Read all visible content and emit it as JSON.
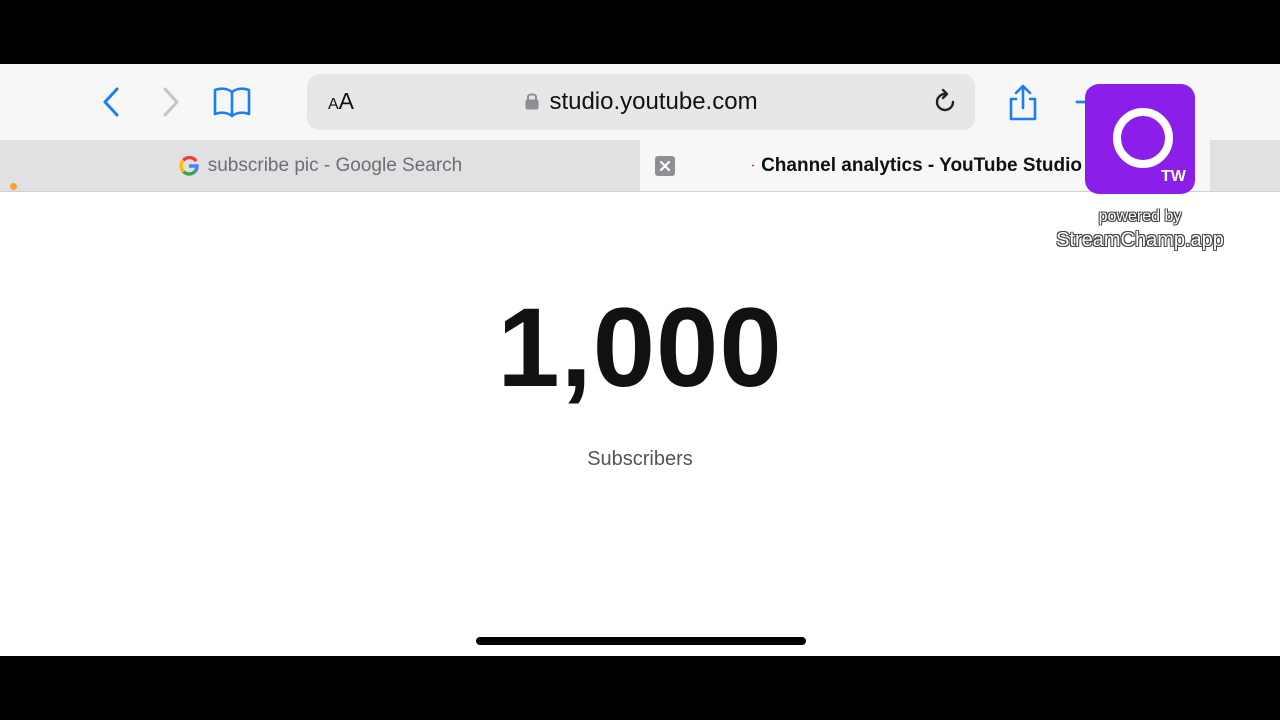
{
  "browser": {
    "address_bar": {
      "text_size_label_small": "A",
      "text_size_label_large": "A",
      "url": "studio.youtube.com"
    },
    "tabs": [
      {
        "title": "subscribe pic - Google Search",
        "favicon": "google-icon",
        "active": false
      },
      {
        "title": "Channel analytics - YouTube Studio",
        "favicon": "youtube-icon",
        "active": true
      }
    ]
  },
  "page": {
    "subscriber_count": "1,000",
    "subscriber_label": "Subscribers"
  },
  "overlay": {
    "logo_badge": "TW",
    "powered_by": "powered by",
    "brand": "StreamChamp.app"
  },
  "colors": {
    "ios_blue": "#1a7ff5",
    "youtube_red": "#ff0000",
    "streamchamp_purple": "#8b1ee9"
  }
}
